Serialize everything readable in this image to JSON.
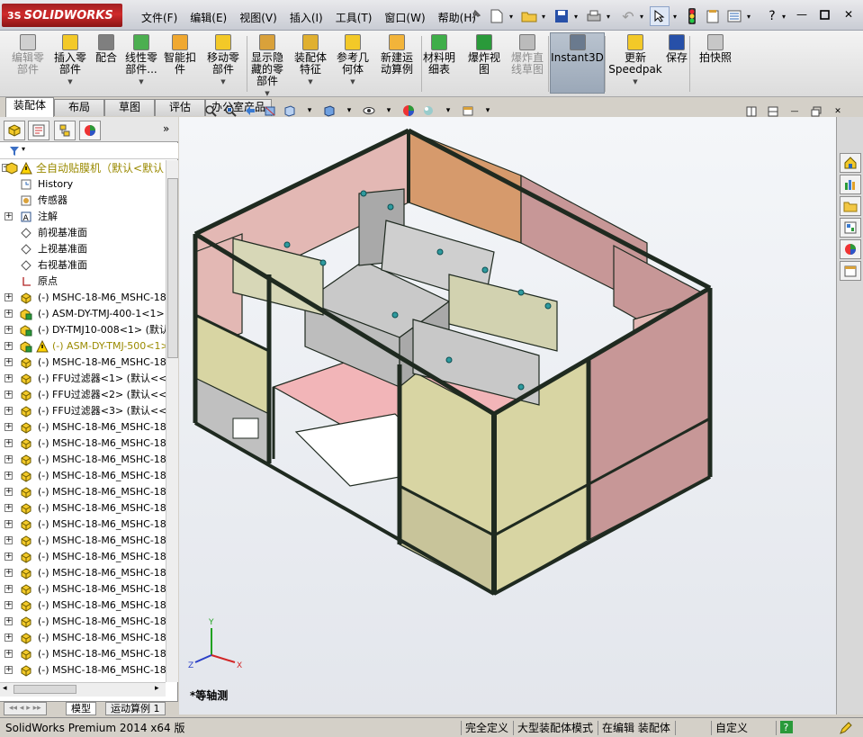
{
  "app": {
    "brand_ds": "3S",
    "brand_name": "SOLIDWORKS"
  },
  "menu": [
    "文件(F)",
    "编辑(E)",
    "视图(V)",
    "插入(I)",
    "工具(T)",
    "窗口(W)",
    "帮助(H)"
  ],
  "command_manager": {
    "buttons": [
      {
        "label": "编辑零\n部件",
        "disabled": true,
        "icon": "edit-component-icon"
      },
      {
        "label": "插入零\n部件",
        "disabled": false,
        "icon": "insert-component-icon"
      },
      {
        "label": "配合",
        "disabled": false,
        "icon": "mate-icon"
      },
      {
        "label": "线性零\n部件...",
        "disabled": false,
        "icon": "linear-pattern-icon"
      },
      {
        "label": "智能扣\n件",
        "disabled": false,
        "icon": "smart-fastener-icon"
      },
      {
        "label": "移动零\n部件",
        "disabled": false,
        "icon": "move-component-icon"
      },
      {
        "label": "显示隐\n藏的零\n部件",
        "disabled": false,
        "icon": "show-hidden-icon"
      },
      {
        "label": "装配体\n特征",
        "disabled": false,
        "icon": "assembly-feature-icon"
      },
      {
        "label": "参考几\n何体",
        "disabled": false,
        "icon": "reference-geometry-icon"
      },
      {
        "label": "新建运\n动算例",
        "disabled": false,
        "icon": "new-motion-study-icon"
      },
      {
        "label": "材料明\n细表",
        "disabled": false,
        "icon": "bill-of-materials-icon"
      },
      {
        "label": "爆炸视\n图",
        "disabled": false,
        "icon": "exploded-view-icon"
      },
      {
        "label": "爆炸直\n线草图",
        "disabled": true,
        "icon": "explode-line-sketch-icon"
      },
      {
        "label": "Instant3D",
        "disabled": false,
        "icon": "instant3d-icon"
      },
      {
        "label": "更新\nSpeedpak",
        "disabled": false,
        "icon": "update-speedpak-icon"
      },
      {
        "label": "保存",
        "disabled": false,
        "icon": "save-icon"
      },
      {
        "label": "拍快照",
        "disabled": false,
        "icon": "snapshot-icon"
      }
    ]
  },
  "tabs": [
    "装配体",
    "布局",
    "草图",
    "评估",
    "办公室产品"
  ],
  "tree": {
    "root": "全自动贴膜机（默认<默认",
    "items": [
      {
        "text": "History",
        "icon": "history-icon",
        "expand": false
      },
      {
        "text": "传感器",
        "icon": "sensor-icon",
        "expand": false
      },
      {
        "text": "注解",
        "icon": "annotation-icon",
        "expand": true
      },
      {
        "text": "前视基准面",
        "icon": "plane-icon",
        "expand": false
      },
      {
        "text": "上视基准面",
        "icon": "plane-icon",
        "expand": false
      },
      {
        "text": "右视基准面",
        "icon": "plane-icon",
        "expand": false
      },
      {
        "text": "原点",
        "icon": "origin-icon",
        "expand": false
      },
      {
        "text": "(-) MSHC-18-M6_MSHC-18-M",
        "icon": "part-icon",
        "expand": true
      },
      {
        "text": "(-) ASM-DY-TMJ-400-1<1> (",
        "icon": "assembly-icon",
        "expand": true
      },
      {
        "text": "(-) DY-TMJ10-008<1> (默认",
        "icon": "assembly-icon",
        "expand": true
      },
      {
        "text": "(-) ASM-DY-TMJ-500<1>",
        "icon": "warning-assembly-icon",
        "expand": true,
        "warn": true
      },
      {
        "text": "(-) MSHC-18-M6_MSHC-18-M",
        "icon": "part-icon",
        "expand": true
      },
      {
        "text": "(-) FFU过滤器<1> (默认<<",
        "icon": "part-icon",
        "expand": true
      },
      {
        "text": "(-) FFU过滤器<2> (默认<<",
        "icon": "part-icon",
        "expand": true
      },
      {
        "text": "(-) FFU过滤器<3> (默认<<",
        "icon": "part-icon",
        "expand": true
      },
      {
        "text": "(-) MSHC-18-M6_MSHC-18-M",
        "icon": "part-icon",
        "expand": true
      },
      {
        "text": "(-) MSHC-18-M6_MSHC-18-M",
        "icon": "part-icon",
        "expand": true
      },
      {
        "text": "(-) MSHC-18-M6_MSHC-18-M",
        "icon": "part-icon",
        "expand": true
      },
      {
        "text": "(-) MSHC-18-M6_MSHC-18-M",
        "icon": "part-icon",
        "expand": true
      },
      {
        "text": "(-) MSHC-18-M6_MSHC-18-M",
        "icon": "part-icon",
        "expand": true
      },
      {
        "text": "(-) MSHC-18-M6_MSHC-18-M",
        "icon": "part-icon",
        "expand": true
      },
      {
        "text": "(-) MSHC-18-M6_MSHC-18-M",
        "icon": "part-icon",
        "expand": true
      },
      {
        "text": "(-) MSHC-18-M6_MSHC-18-M",
        "icon": "part-icon",
        "expand": true
      },
      {
        "text": "(-) MSHC-18-M6_MSHC-18-M",
        "icon": "part-icon",
        "expand": true
      },
      {
        "text": "(-) MSHC-18-M6_MSHC-18-M",
        "icon": "part-icon",
        "expand": true
      },
      {
        "text": "(-) MSHC-18-M6_MSHC-18-M",
        "icon": "part-icon",
        "expand": true
      },
      {
        "text": "(-) MSHC-18-M6_MSHC-18-M",
        "icon": "part-icon",
        "expand": true
      },
      {
        "text": "(-) MSHC-18-M6_MSHC-18-M",
        "icon": "part-icon",
        "expand": true
      },
      {
        "text": "(-) MSHC-18-M6_MSHC-18-M",
        "icon": "part-icon",
        "expand": true
      },
      {
        "text": "(-) MSHC-18-M6_MSHC-18-M",
        "icon": "part-icon",
        "expand": true
      },
      {
        "text": "(-) MSHC-18-M6_MSHC-18-M",
        "icon": "part-icon",
        "expand": true
      }
    ]
  },
  "bottom_tabs": [
    "模型",
    "运动算例 1"
  ],
  "viewport": {
    "view_name": "*等轴测",
    "triad": {
      "x": "X",
      "y": "Y",
      "z": "Z"
    }
  },
  "status": {
    "product": "SolidWorks Premium 2014 x64 版",
    "defined": "完全定义",
    "mode": "大型装配体模式",
    "editing": "在编辑 装配体",
    "units": "自定义"
  },
  "colors": {
    "frame": "#1f2a20",
    "panel_tan": "#d8d5a3",
    "panel_pink": "#e3b8b4",
    "panel_orange": "#d69a6c",
    "panel_rose": "#c79797",
    "floor": "#f2b5b8",
    "machine": "#c9c9c9",
    "accent": "#2e9a9e"
  }
}
